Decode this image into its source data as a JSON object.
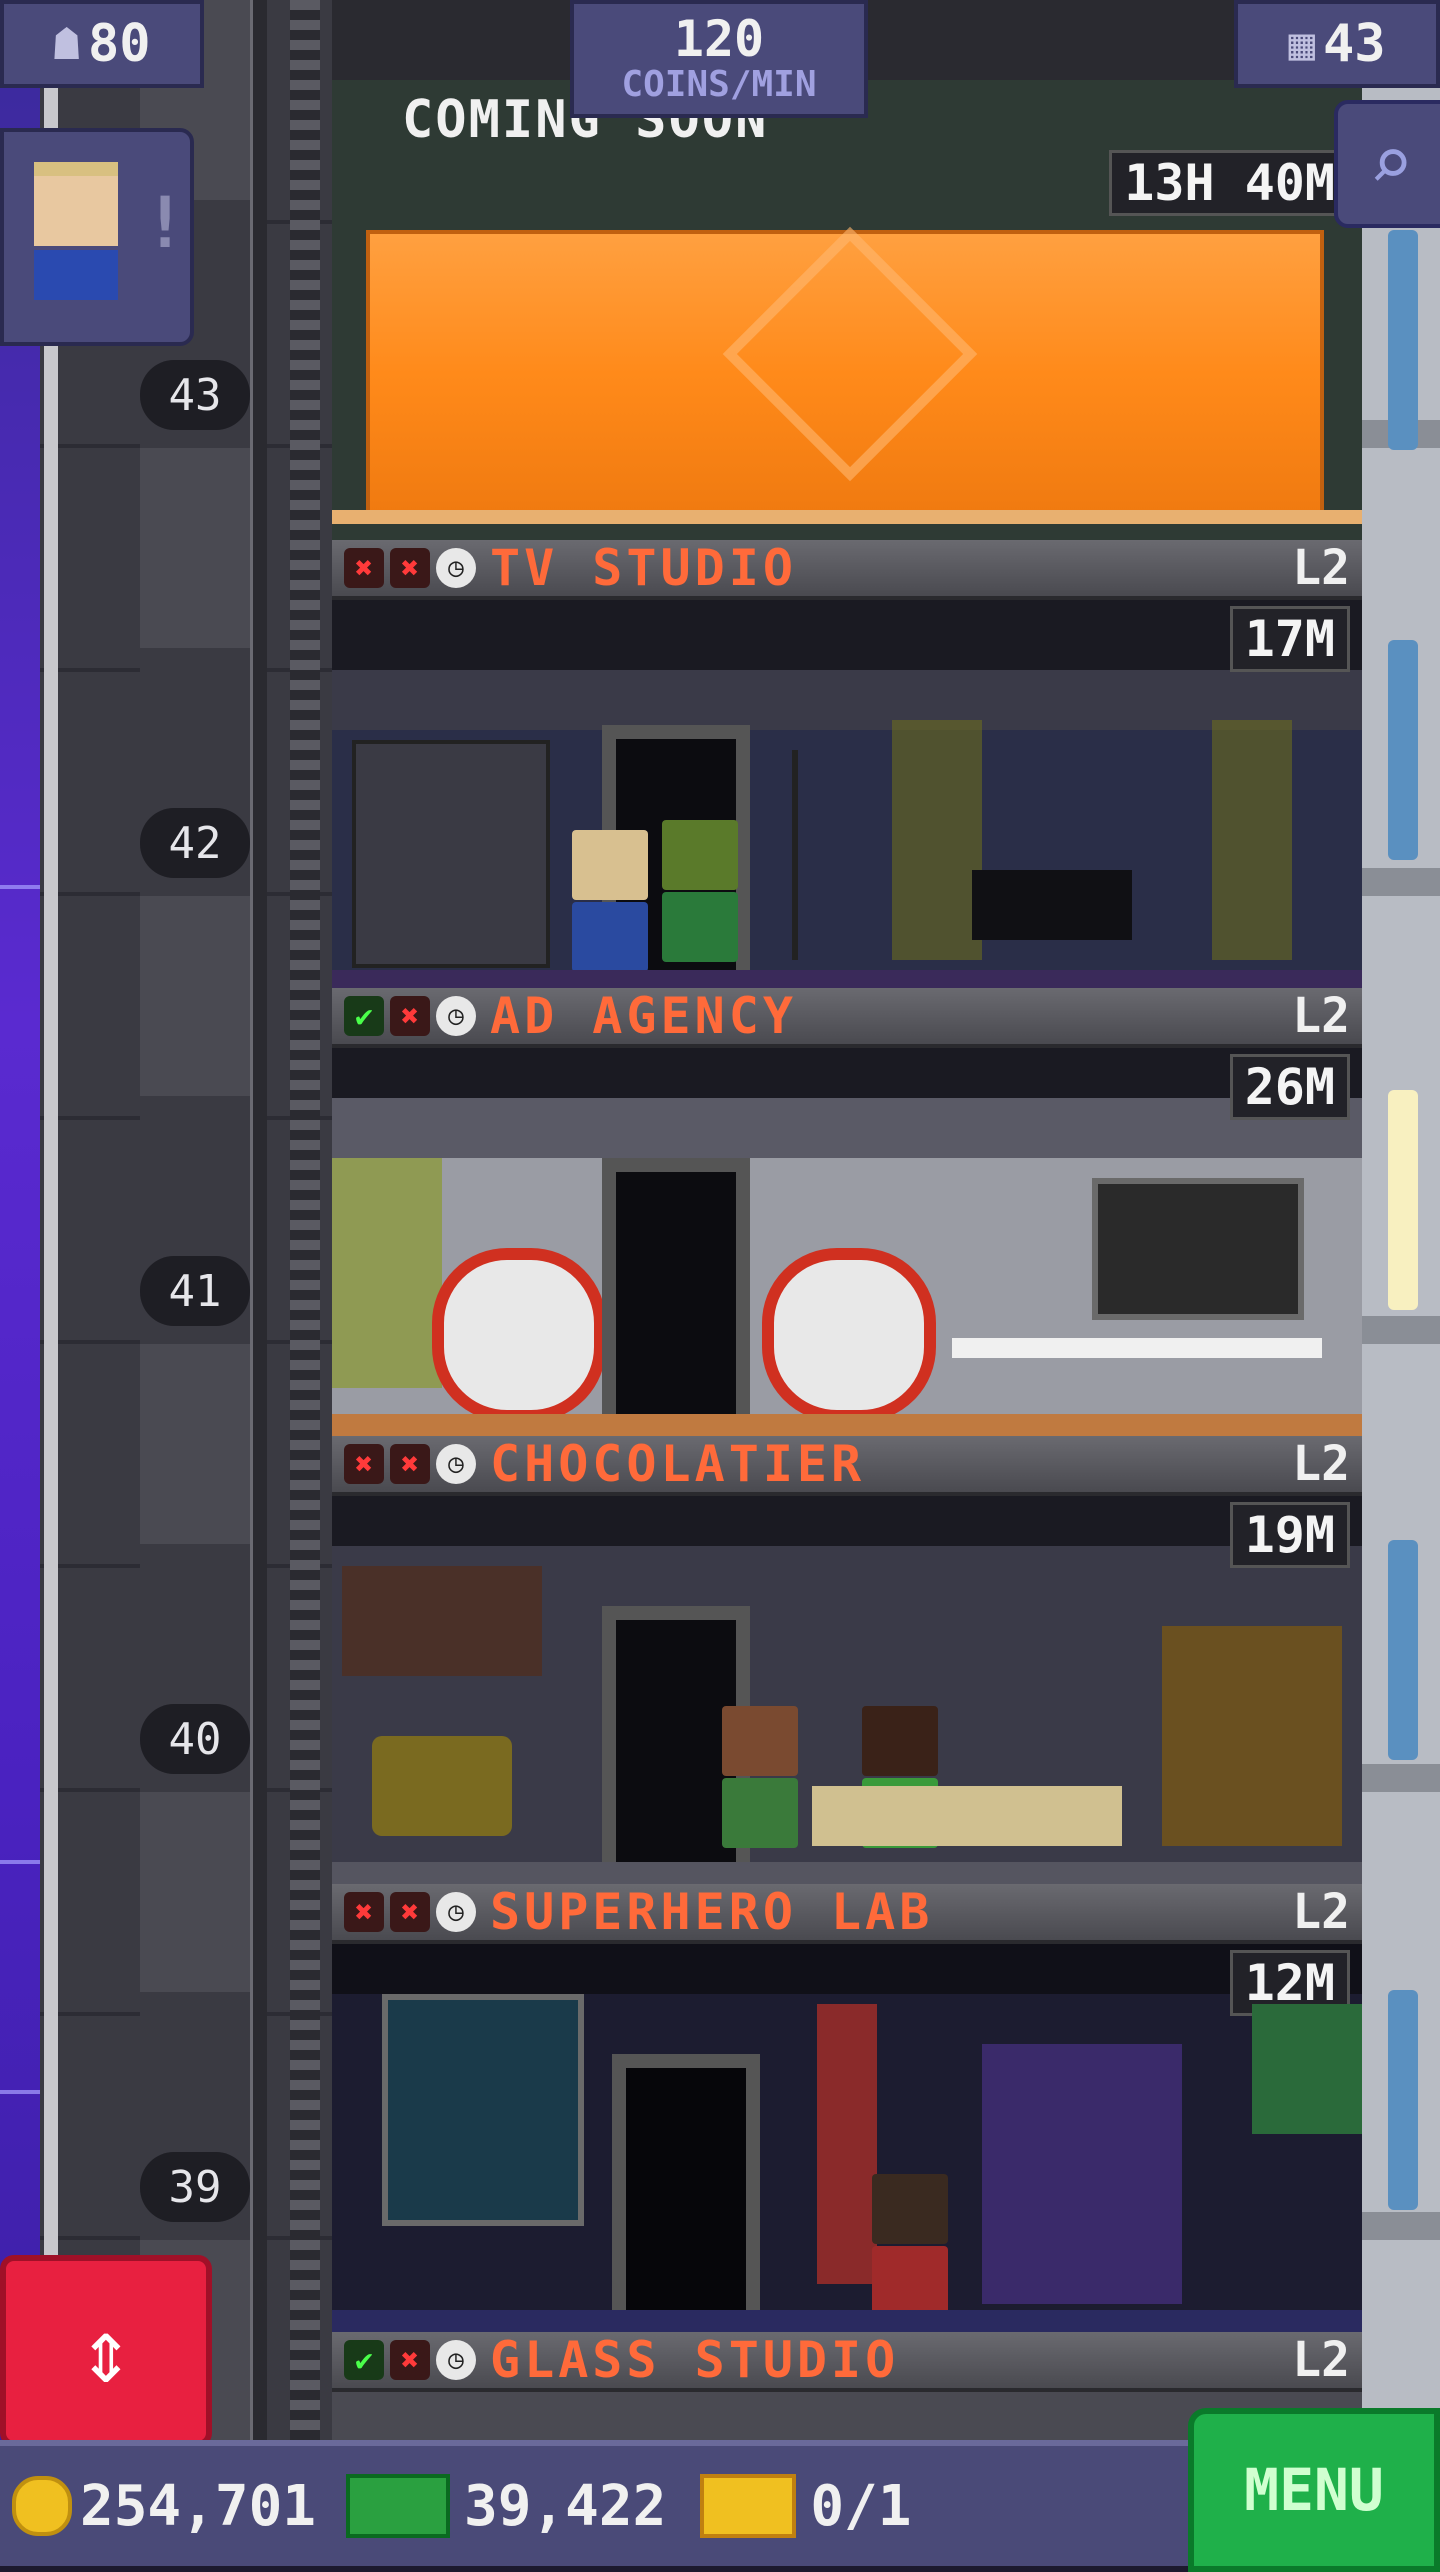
{
  "top_bar": {
    "population": "80",
    "coins_rate_value": "120",
    "coins_rate_unit": "COINS/MIN",
    "floors": "43"
  },
  "construction": {
    "banner": "COMING SOON",
    "timer": "13H 40M"
  },
  "floors": [
    {
      "number": "43",
      "name": "TV STUDIO",
      "level": "L2",
      "timer": "17M",
      "status": [
        "bad",
        "bad",
        "clock"
      ]
    },
    {
      "number": "42",
      "name": "AD AGENCY",
      "level": "L2",
      "timer": "26M",
      "status": [
        "ok",
        "bad",
        "clock"
      ]
    },
    {
      "number": "41",
      "name": "CHOCOLATIER",
      "level": "L2",
      "timer": "19M",
      "status": [
        "bad",
        "bad",
        "clock"
      ]
    },
    {
      "number": "40",
      "name": "SUPERHERO LAB",
      "level": "L2",
      "timer": "12M",
      "status": [
        "bad",
        "bad",
        "clock"
      ]
    },
    {
      "number": "39",
      "name": "GLASS STUDIO",
      "level": "L2",
      "timer": "",
      "status": [
        "ok",
        "bad",
        "clock"
      ]
    }
  ],
  "shaft_numbers": [
    "43",
    "42",
    "41",
    "40",
    "39"
  ],
  "bottom_bar": {
    "coins": "254,701",
    "bux": "39,422",
    "tickets": "0/1",
    "menu_label": "MENU"
  },
  "colors": {
    "floor_name": "#ff6a3a",
    "menu_green": "#1fb04a",
    "elevator_red": "#e82040",
    "ui_purple": "#4a4a7a"
  }
}
